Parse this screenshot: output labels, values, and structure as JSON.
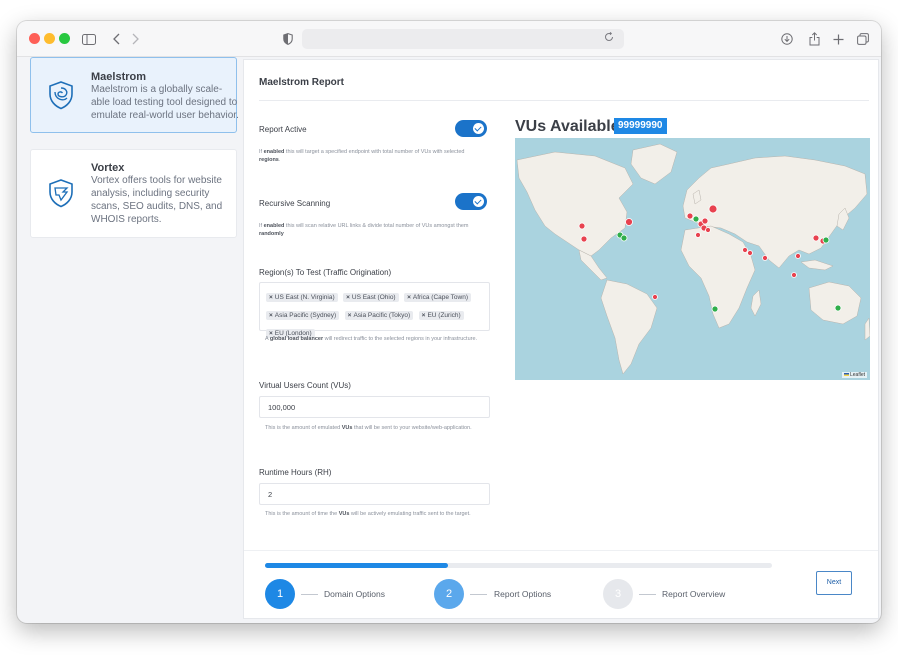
{
  "sidebar": {
    "items": [
      {
        "title": "Maelstrom",
        "description": "Maelstrom is a globally scale-able load testing tool designed to emulate real-world user behavior."
      },
      {
        "title": "Vortex",
        "description": "Vortex offers tools for website analysis, including security scans, SEO audits, DNS, and WHOIS reports."
      }
    ]
  },
  "report": {
    "title": "Maelstrom Report",
    "report_active": {
      "label": "Report Active",
      "help_pre": "If ",
      "help_b1": "enabled",
      "help_mid": " this will target a specified endpoint with total number of VUs with selected ",
      "help_b2": "regions",
      "help_end": ".",
      "enabled": true
    },
    "recursive": {
      "label": "Recursive Scanning",
      "help_pre": "If ",
      "help_b1": "enabled",
      "help_mid": " this will scan relative URL links & divide total number of VUs amongst them ",
      "help_b2": "randomly",
      "enabled": true
    },
    "regions": {
      "label": "Region(s) To Test (Traffic Origination)",
      "tags": [
        "US East (N. Virginia)",
        "US East (Ohio)",
        "Africa (Cape Town)",
        "Asia Pacific (Sydney)",
        "Asia Pacific (Tokyo)",
        "EU (Zurich)",
        "EU (London)"
      ],
      "help_pre": "A ",
      "help_b": "global load balancer",
      "help_end": " will redirect traffic to the selected regions in your infrastructure."
    },
    "vus": {
      "label": "Virtual Users Count (VUs)",
      "value": "100,000",
      "help_pre": "This is the amount of emulated ",
      "help_b": "VUs",
      "help_end": " that will be sent to your website/web-application."
    },
    "runtime": {
      "label": "Runtime Hours (RH)",
      "value": "2",
      "help_pre": "This is the amount of time the ",
      "help_b": "VUs",
      "help_end": " will be actively emulating traffic sent to the target."
    }
  },
  "vus_available": {
    "label": "VUs Available:",
    "value": "99999990"
  },
  "map": {
    "attribution": "Leaflet"
  },
  "footer": {
    "progress": 0.36,
    "steps": [
      {
        "number": "1",
        "label": "Domain Options",
        "color": "#1e88e5"
      },
      {
        "number": "2",
        "label": "Report Options",
        "color": "#5ba8ec"
      },
      {
        "number": "3",
        "label": "Report Overview",
        "color": "#e6e8ec"
      }
    ],
    "next_label": "Next"
  },
  "colors": {
    "accent": "#1e88e5",
    "toggle": "#1b73c9",
    "marker_red": "#e8424f",
    "marker_green": "#2fae4a"
  }
}
